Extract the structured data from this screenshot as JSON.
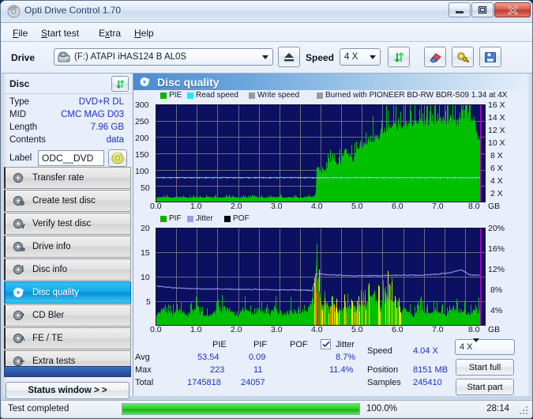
{
  "window": {
    "title": "Opti Drive Control 1.70",
    "icon": "disc-icon",
    "minimize_label": "Minimize",
    "maximize_label": "Maximize",
    "close_label": "Close"
  },
  "menu": [
    {
      "label": "File",
      "mnemonic": "F"
    },
    {
      "label": "Start test",
      "mnemonic": "S"
    },
    {
      "label": "Extra",
      "mnemonic": "x"
    },
    {
      "label": "Help",
      "mnemonic": "H"
    }
  ],
  "toolbar": {
    "drive_label": "Drive",
    "drive_value": "(F:)  ATAPI iHAS124   B AL0S",
    "eject_label": "Eject",
    "speed_label": "Speed",
    "speed_value": "4 X",
    "refresh_label": "Refresh",
    "erase_label": "Erase",
    "settings_label": "Settings",
    "save_label": "Save"
  },
  "disc": {
    "header": "Disc",
    "refresh_label": "Refresh disc",
    "rows": [
      {
        "key": "Type",
        "value": "DVD+R DL"
      },
      {
        "key": "MID",
        "value": "CMC MAG D03"
      },
      {
        "key": "Length",
        "value": "7.96 GB"
      },
      {
        "key": "Contents",
        "value": "data"
      }
    ],
    "label_key": "Label",
    "label_value": "ODC__DVD",
    "label_placeholder": "",
    "disc_icon_label": "Disc properties"
  },
  "nav": {
    "items": [
      {
        "label": "Transfer rate",
        "icon": "disc-transfer-icon",
        "active": false
      },
      {
        "label": "Create test disc",
        "icon": "disc-create-icon",
        "active": false
      },
      {
        "label": "Verify test disc",
        "icon": "disc-verify-icon",
        "active": false
      },
      {
        "label": "Drive info",
        "icon": "disc-drive-icon",
        "active": false
      },
      {
        "label": "Disc info",
        "icon": "disc-info-icon",
        "active": false
      },
      {
        "label": "Disc quality",
        "icon": "disc-quality-icon",
        "active": true
      },
      {
        "label": "CD Bler",
        "icon": "disc-bler-icon",
        "active": false
      },
      {
        "label": "FE / TE",
        "icon": "disc-fete-icon",
        "active": false
      },
      {
        "label": "Extra tests",
        "icon": "disc-extra-icon",
        "active": false
      }
    ],
    "status_window_label": "Status window > >"
  },
  "panel": {
    "title": "Disc quality",
    "title_icon": "disc-quality-icon"
  },
  "chart_data": [
    {
      "type": "area",
      "id": "pie-chart",
      "title": "",
      "xlabel": "GB",
      "ylabel": "",
      "xlim": [
        0,
        8.2
      ],
      "ylim": [
        0,
        300
      ],
      "y2lim": [
        0,
        16
      ],
      "y2label": "X",
      "grid": true,
      "legend_position": "top",
      "legend": [
        {
          "name": "PIE",
          "color": "#00b400"
        },
        {
          "name": "Read speed",
          "color": "#00e5ff"
        },
        {
          "name": "Write speed",
          "color": "#9a9a9a"
        },
        {
          "name": "Burned with PIONEER BD-RW   BDR-S09 1.34 at 4X",
          "color": "#9a9a9a"
        }
      ],
      "xticks": [
        "0.0",
        "1.0",
        "2.0",
        "3.0",
        "4.0",
        "5.0",
        "6.0",
        "7.0",
        "8.0"
      ],
      "yticks": [
        "300",
        "250",
        "200",
        "150",
        "100",
        "50"
      ],
      "y2ticks": [
        "16 X",
        "14 X",
        "12 X",
        "10 X",
        "8 X",
        "6 X",
        "4 X",
        "2 X"
      ],
      "series": [
        {
          "name": "PIE",
          "color": "#00c000",
          "x": [
            0.0,
            0.1,
            0.2,
            0.3,
            0.4,
            0.5,
            0.6,
            0.7,
            0.8,
            0.9,
            1.0,
            1.1,
            1.2,
            1.3,
            1.4,
            1.5,
            1.6,
            1.7,
            1.8,
            1.9,
            2.0,
            2.1,
            2.2,
            2.3,
            2.4,
            2.5,
            2.6,
            2.7,
            2.8,
            2.9,
            3.0,
            3.1,
            3.2,
            3.3,
            3.4,
            3.5,
            3.6,
            3.7,
            3.8,
            3.9,
            3.98,
            4.0,
            4.05,
            4.1,
            4.2,
            4.3,
            4.4,
            4.5,
            4.6,
            4.7,
            4.8,
            4.9,
            5.0,
            5.1,
            5.2,
            5.3,
            5.4,
            5.5,
            5.6,
            5.7,
            5.8,
            5.9,
            6.0,
            6.1,
            6.2,
            6.3,
            6.4,
            6.5,
            6.6,
            6.7,
            6.8,
            6.9,
            7.0,
            7.1,
            7.2,
            7.3,
            7.4,
            7.5,
            7.6,
            7.7,
            7.8,
            7.9,
            8.0
          ],
          "values": [
            14,
            16,
            15,
            18,
            14,
            17,
            15,
            16,
            14,
            15,
            16,
            15,
            14,
            17,
            15,
            16,
            14,
            15,
            17,
            16,
            15,
            14,
            16,
            15,
            17,
            15,
            16,
            14,
            15,
            16,
            15,
            17,
            14,
            16,
            15,
            16,
            14,
            15,
            17,
            16,
            22,
            95,
            100,
            88,
            92,
            110,
            135,
            108,
            120,
            150,
            142,
            128,
            160,
            175,
            168,
            190,
            182,
            205,
            198,
            215,
            222,
            230,
            218,
            235,
            228,
            240,
            232,
            245,
            238,
            243,
            250,
            242,
            235,
            248,
            240,
            252,
            245,
            238,
            250,
            262,
            255,
            248,
            200
          ]
        },
        {
          "name": "Read speed",
          "color": "#00e5ff",
          "units": "X",
          "x": [
            0.0,
            0.5,
            1.0,
            1.5,
            2.0,
            2.5,
            3.0,
            3.5,
            3.9,
            4.0,
            4.5,
            5.0,
            5.5,
            6.0,
            6.5,
            7.0,
            7.5,
            8.0
          ],
          "values": [
            4.05,
            4.04,
            4.04,
            4.04,
            4.04,
            4.04,
            4.04,
            4.04,
            4.04,
            4.04,
            4.04,
            4.04,
            4.04,
            4.04,
            4.04,
            4.04,
            4.04,
            4.04
          ]
        }
      ]
    },
    {
      "type": "area",
      "id": "pif-chart",
      "title": "",
      "xlabel": "GB",
      "ylabel": "",
      "xlim": [
        0,
        8.2
      ],
      "ylim": [
        0,
        20
      ],
      "y2lim": [
        0,
        20
      ],
      "y2label": "%",
      "grid": true,
      "legend_position": "top",
      "legend": [
        {
          "name": "PIF",
          "color": "#00b400"
        },
        {
          "name": "Jitter",
          "color": "#9a9cf0"
        },
        {
          "name": "POF",
          "color": "#000000"
        }
      ],
      "xticks": [
        "0.0",
        "1.0",
        "2.0",
        "3.0",
        "4.0",
        "5.0",
        "6.0",
        "7.0",
        "8.0"
      ],
      "yticks": [
        "20",
        "15",
        "10",
        "5"
      ],
      "y2ticks": [
        "20%",
        "16%",
        "12%",
        "8%",
        "4%"
      ],
      "series": [
        {
          "name": "PIF",
          "color": "#00c000",
          "x": [
            0.0,
            0.2,
            0.4,
            0.6,
            0.8,
            1.0,
            1.2,
            1.4,
            1.6,
            1.8,
            2.0,
            2.2,
            2.4,
            2.6,
            2.8,
            3.0,
            3.2,
            3.4,
            3.6,
            3.8,
            3.95,
            4.0,
            4.05,
            4.2,
            4.4,
            4.6,
            4.8,
            5.0,
            5.2,
            5.4,
            5.6,
            5.8,
            6.0,
            6.2,
            6.4,
            6.6,
            6.8,
            7.0,
            7.2,
            7.4,
            7.6,
            7.8,
            8.0
          ],
          "values": [
            2,
            3,
            2,
            3,
            2,
            3,
            2,
            2,
            3,
            3,
            2,
            3,
            2,
            3,
            2,
            3,
            2,
            3,
            2,
            3,
            5,
            11,
            6,
            4,
            3,
            3,
            4,
            3,
            4,
            5,
            4,
            6,
            3,
            3,
            2,
            3,
            2,
            3,
            2,
            3,
            3,
            2,
            3
          ]
        },
        {
          "name": "Jitter",
          "color": "#9a9cf0",
          "units": "%",
          "x": [
            0.0,
            0.5,
            1.0,
            1.5,
            2.0,
            2.5,
            3.0,
            3.5,
            3.9,
            4.0,
            4.5,
            5.0,
            5.5,
            6.0,
            6.5,
            7.0,
            7.3,
            7.6,
            7.8,
            8.0
          ],
          "values": [
            8.1,
            7.7,
            7.5,
            7.5,
            7.4,
            7.4,
            7.3,
            7.3,
            7.2,
            10.6,
            10.3,
            10.2,
            10.2,
            10.3,
            10.3,
            10.5,
            10.8,
            11.4,
            10.4,
            10.3
          ]
        }
      ]
    }
  ],
  "stats": {
    "col_headers": [
      "PIE",
      "PIF",
      "POF",
      "Jitter"
    ],
    "jitter_checked": true,
    "rows": [
      {
        "label": "Avg",
        "pie": "53.54",
        "pif": "0.09",
        "pof": "",
        "jitter": "8.7%"
      },
      {
        "label": "Max",
        "pie": "223",
        "pif": "11",
        "pof": "",
        "jitter": "11.4%"
      },
      {
        "label": "Total",
        "pie": "1745818",
        "pif": "24057",
        "pof": "",
        "jitter": ""
      }
    ],
    "info": [
      {
        "key": "Speed",
        "value": "4.04 X"
      },
      {
        "key": "Position",
        "value": "8151 MB"
      },
      {
        "key": "Samples",
        "value": "245410"
      }
    ],
    "speed_select": "4 X",
    "start_full_label": "Start full",
    "start_part_label": "Start part"
  },
  "statusbar": {
    "message": "Test completed",
    "percent": "100.0%",
    "percent_value": 100,
    "elapsed": "28:14"
  },
  "colors": {
    "accent": "#1a31c8",
    "plot_bg": "#0b1060",
    "pie_green": "#00c000",
    "read_speed_cyan": "#00e5ff",
    "jitter_purple": "#9a9cf0",
    "active_nav": "#10a8e8",
    "progress_green": "#2fcd2f"
  }
}
